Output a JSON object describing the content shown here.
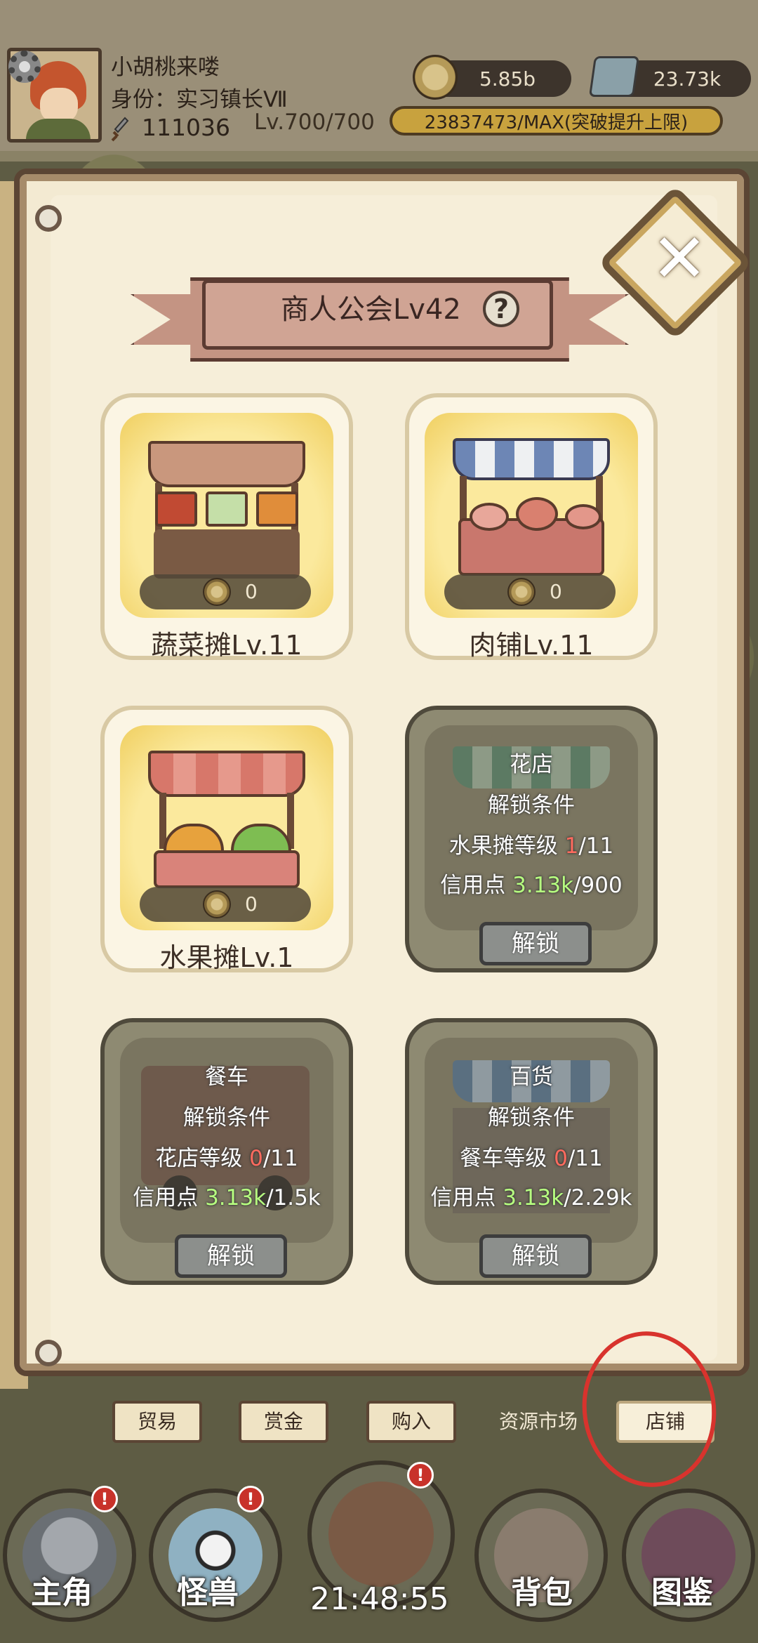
{
  "player": {
    "name": "小胡桃来喽",
    "title": "身份：实习镇长Ⅶ",
    "power": "111036",
    "level": "Lv.700/700",
    "gold": "5.85b",
    "gems": "23.73k",
    "exp": "23837473/MAX(突破提升上限)"
  },
  "guild": {
    "title": "商人公会Lv42",
    "help_symbol": "?",
    "close_symbol": "✕"
  },
  "shops": [
    {
      "name": "蔬菜摊Lv.11",
      "coins": "0",
      "locked": false
    },
    {
      "name": "肉铺Lv.11",
      "coins": "0",
      "locked": false
    },
    {
      "name": "水果摊Lv.1",
      "coins": "0",
      "locked": false
    },
    {
      "name": "花店",
      "locked": true,
      "cond_title": "解锁条件",
      "cond1_label": "水果摊等级 ",
      "cond1_cur": "1",
      "cond1_max": "/11",
      "cond2_label": "信用点 ",
      "cond2_cur": "3.13k",
      "cond2_max": "/900",
      "button": "解锁"
    },
    {
      "name": "餐车",
      "locked": true,
      "cond_title": "解锁条件",
      "cond1_label": "花店等级 ",
      "cond1_cur": "0",
      "cond1_max": "/11",
      "cond2_label": "信用点 ",
      "cond2_cur": "3.13k",
      "cond2_max": "/1.5k",
      "button": "解锁"
    },
    {
      "name": "百货",
      "locked": true,
      "cond_title": "解锁条件",
      "cond1_label": "餐车等级 ",
      "cond1_cur": "0",
      "cond1_max": "/11",
      "cond2_label": "信用点 ",
      "cond2_cur": "3.13k",
      "cond2_max": "/2.29k",
      "button": "解锁"
    }
  ],
  "tabs": [
    "贸易",
    "赏金",
    "购入",
    "资源市场",
    "店铺"
  ],
  "active_tab": "店铺",
  "nav": {
    "items": [
      {
        "label": "主角",
        "badge": "!"
      },
      {
        "label": "怪兽",
        "badge": "!"
      },
      {
        "label": "",
        "badge": "!"
      },
      {
        "label": "背包"
      },
      {
        "label": "图鉴"
      }
    ],
    "clock": "21:48:55"
  },
  "colors": {
    "panel": "#f3ead2",
    "accent_red": "#ff6b5e",
    "accent_green": "#b7ff80",
    "annotation_circle": "#d8332d"
  }
}
